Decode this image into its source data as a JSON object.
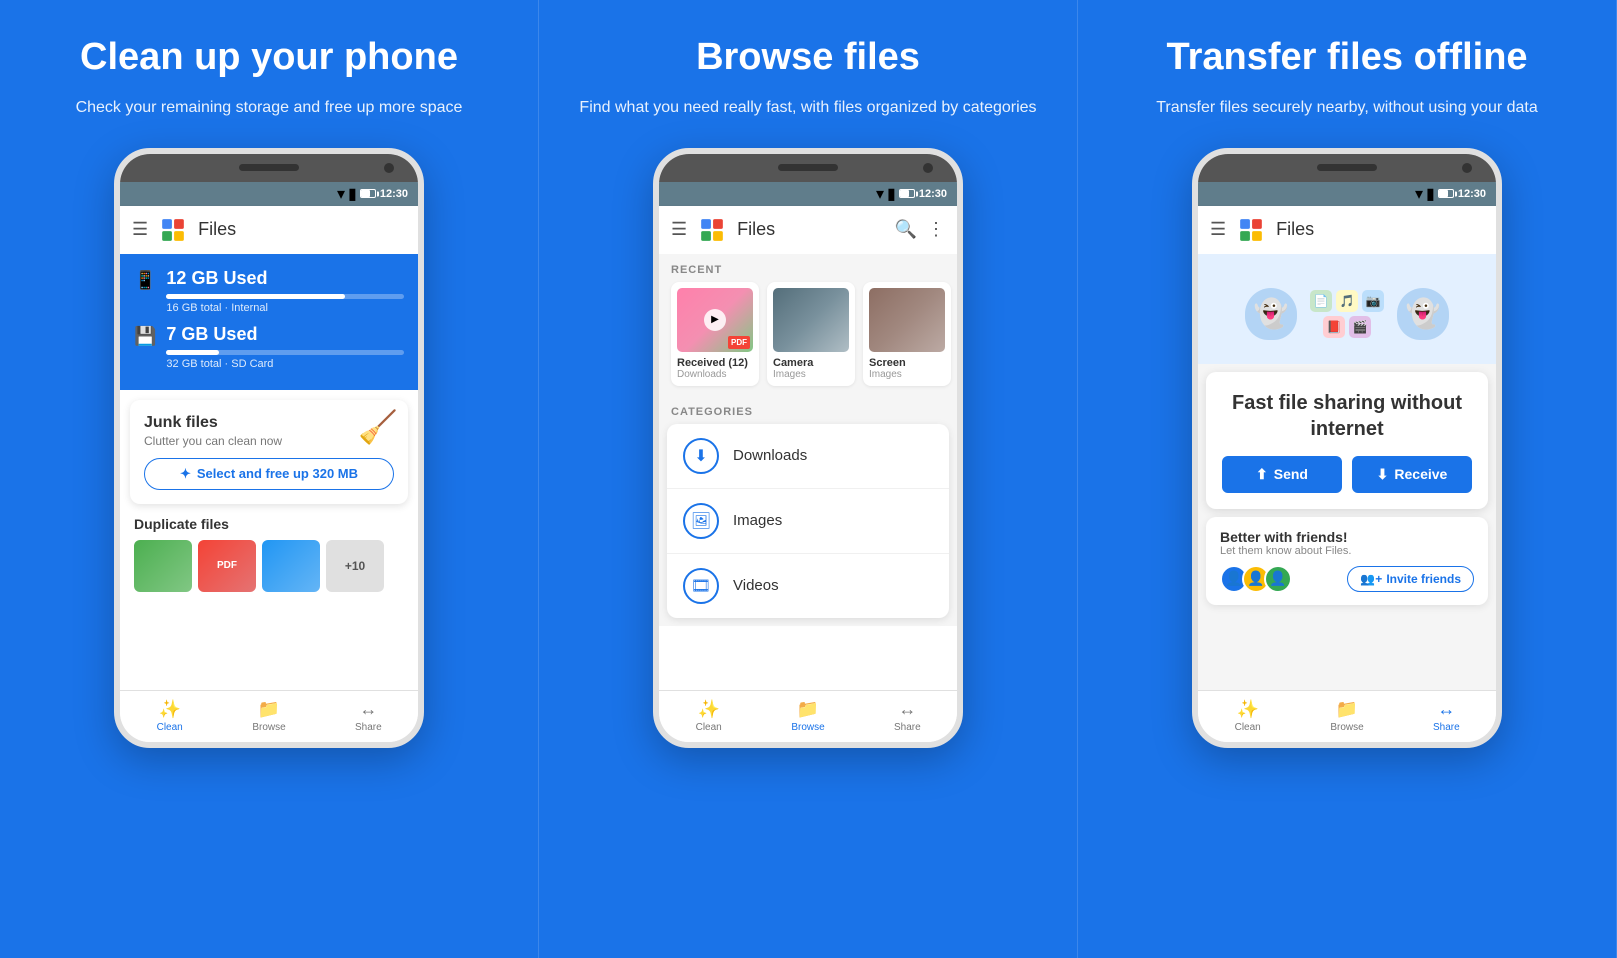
{
  "panels": [
    {
      "id": "clean",
      "title": "Clean up your phone",
      "subtitle": "Check your remaining storage\nand free up more space",
      "phone": {
        "status_time": "12:30",
        "app_title": "Files",
        "storage": [
          {
            "label": "12 GB Used",
            "detail": "16 GB total · Internal",
            "fill": 75
          },
          {
            "label": "7 GB Used",
            "detail": "32 GB total · SD Card",
            "fill": 22
          }
        ],
        "junk": {
          "title": "Junk files",
          "subtitle": "Clutter you can clean now",
          "cta": "Select and free up 320 MB"
        },
        "dup_title": "Duplicate files",
        "nav": [
          "Clean",
          "Browse",
          "Share"
        ]
      }
    },
    {
      "id": "browse",
      "title": "Browse files",
      "subtitle": "Find what you need really fast, with\nfiles organized by categories",
      "phone": {
        "status_time": "12:30",
        "app_title": "Files",
        "recent_label": "RECENT",
        "recent": [
          {
            "name": "Received (12)",
            "sub": "Downloads",
            "type": "flowers"
          },
          {
            "name": "Camera",
            "sub": "Images",
            "type": "sky"
          },
          {
            "name": "Screen",
            "sub": "Images",
            "type": "food"
          }
        ],
        "categories_label": "CATEGORIES",
        "categories": [
          {
            "icon": "⬇",
            "name": "Downloads"
          },
          {
            "icon": "🖼",
            "name": "Images"
          },
          {
            "icon": "🎞",
            "name": "Videos"
          }
        ],
        "nav": [
          "Clean",
          "Browse",
          "Share"
        ],
        "active_nav": 1
      }
    },
    {
      "id": "transfer",
      "title": "Transfer files offline",
      "subtitle": "Transfer files securely nearby,\nwithout using your data",
      "phone": {
        "status_time": "12:30",
        "app_title": "Files",
        "fast_share": {
          "title": "Fast file sharing\nwithout internet",
          "send_label": "Send",
          "receive_label": "Receive"
        },
        "invite": {
          "title": "Better with friends!",
          "subtitle": "Let them know about Files.",
          "btn_label": "Invite friends"
        },
        "nav": [
          "Clean",
          "Browse",
          "Share"
        ],
        "active_nav": 2
      }
    }
  ]
}
